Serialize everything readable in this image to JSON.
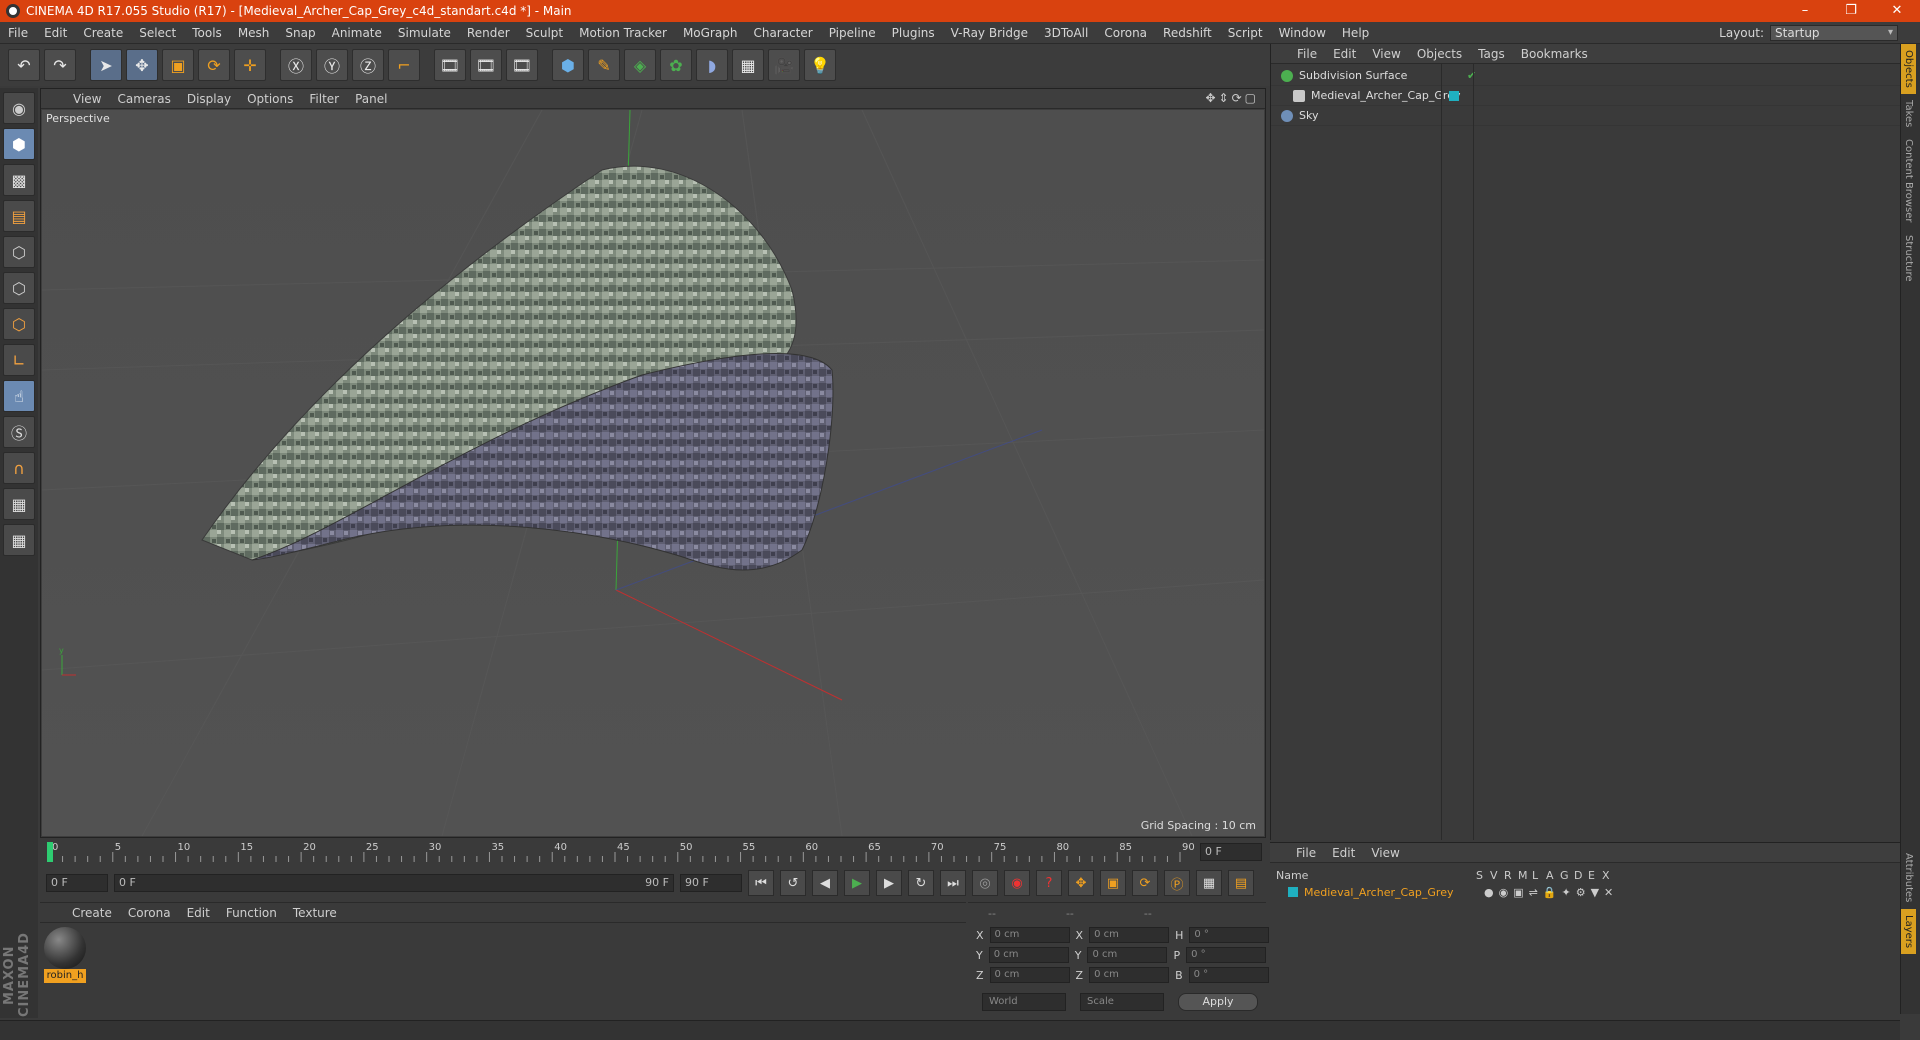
{
  "window": {
    "title": "CINEMA 4D R17.055 Studio (R17) - [Medieval_Archer_Cap_Grey_c4d_standart.c4d *] - Main",
    "controls": [
      "–",
      "❐",
      "✕"
    ]
  },
  "menubar": {
    "items": [
      "File",
      "Edit",
      "Create",
      "Select",
      "Tools",
      "Mesh",
      "Snap",
      "Animate",
      "Simulate",
      "Render",
      "Sculpt",
      "Motion Tracker",
      "MoGraph",
      "Character",
      "Pipeline",
      "Plugins",
      "V-Ray Bridge",
      "3DToAll",
      "Corona",
      "Redshift",
      "Script",
      "Window",
      "Help"
    ],
    "layout_label": "Layout:",
    "layout_value": "Startup"
  },
  "viewport": {
    "menu": [
      "View",
      "Cameras",
      "Display",
      "Options",
      "Filter",
      "Panel"
    ],
    "label": "Perspective",
    "grid_spacing": "Grid Spacing : 10 cm"
  },
  "timeline": {
    "ticks": [
      "0",
      "5",
      "10",
      "15",
      "20",
      "25",
      "30",
      "35",
      "40",
      "45",
      "50",
      "55",
      "60",
      "65",
      "70",
      "75",
      "80",
      "85",
      "90"
    ],
    "current_frame": "0 F",
    "start_field": "0 F",
    "range_start": "0 F",
    "range_end": "90 F",
    "end_field": "90 F"
  },
  "material_panel": {
    "menu": [
      "Create",
      "Corona",
      "Edit",
      "Function",
      "Texture"
    ],
    "material_name": "robin_h"
  },
  "coordinates": {
    "headers": [
      "--",
      "--",
      "--"
    ],
    "rows": [
      {
        "a": "X",
        "av": "0 cm",
        "b": "X",
        "bv": "0 cm",
        "c": "H",
        "cv": "0 °"
      },
      {
        "a": "Y",
        "av": "0 cm",
        "b": "Y",
        "bv": "0 cm",
        "c": "P",
        "cv": "0 °"
      },
      {
        "a": "Z",
        "av": "0 cm",
        "b": "Z",
        "bv": "0 cm",
        "c": "B",
        "cv": "0 °"
      }
    ],
    "world": "World",
    "scale": "Scale",
    "apply": "Apply"
  },
  "object_manager": {
    "menu": [
      "File",
      "Edit",
      "View",
      "Objects",
      "Tags",
      "Bookmarks"
    ],
    "objects": [
      {
        "name": "Subdivision Surface",
        "color": "#4caf50"
      },
      {
        "name": "Medieval_Archer_Cap_Grey",
        "color": "#c8c8c8"
      },
      {
        "name": "Sky",
        "color": "#6f8fb8"
      }
    ]
  },
  "side_tabs": [
    "Objects",
    "Takes",
    "Content Browser",
    "Structure",
    "Attributes",
    "Layers"
  ],
  "layer_manager": {
    "menu": [
      "File",
      "Edit",
      "View"
    ],
    "header_name": "Name",
    "columns": [
      "S",
      "V",
      "R",
      "M",
      "L",
      "A",
      "G",
      "D",
      "E",
      "X"
    ],
    "layer_name": "Medieval_Archer_Cap_Grey"
  },
  "colors": {
    "title_bar": "#d9420f",
    "accent": "#f0a020"
  }
}
